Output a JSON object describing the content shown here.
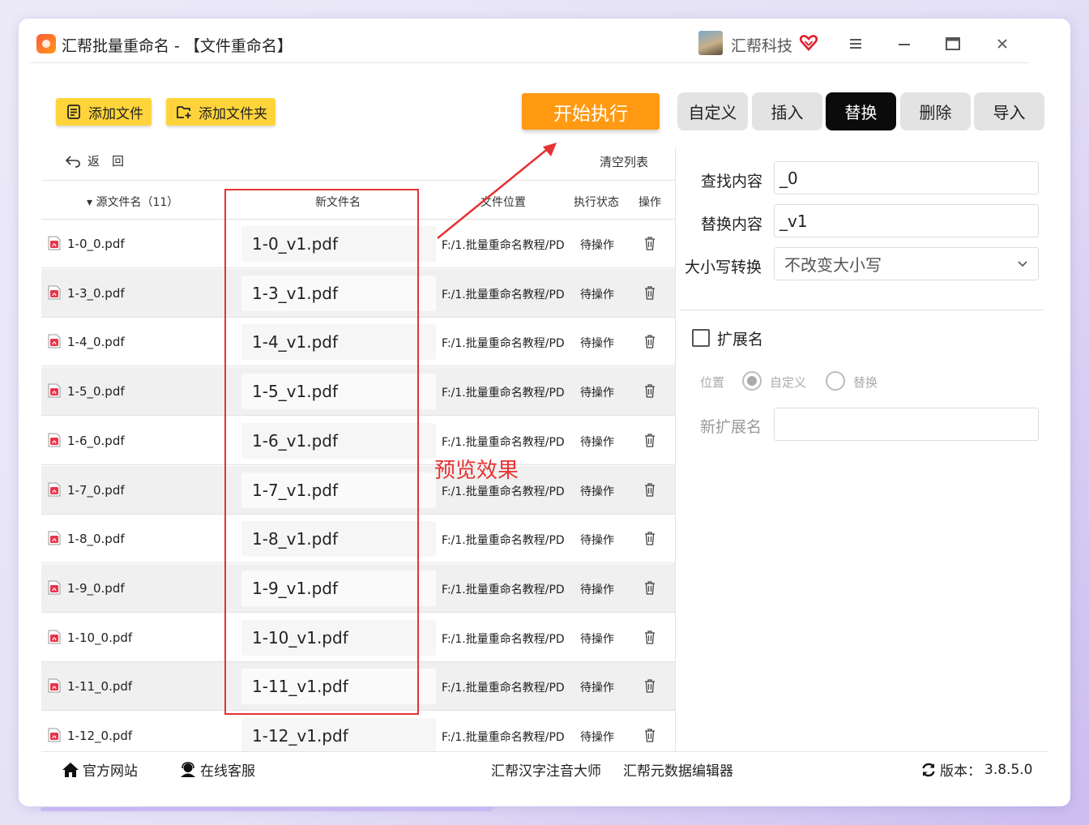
{
  "window": {
    "title": "汇帮批量重命名 - 【文件重命名】",
    "brand": "汇帮科技"
  },
  "toolbar": {
    "add_file": "添加文件",
    "add_folder": "添加文件夹",
    "start": "开始执行"
  },
  "tabs": [
    {
      "label": "自定义",
      "active": false
    },
    {
      "label": "插入",
      "active": false
    },
    {
      "label": "替换",
      "active": true
    },
    {
      "label": "删除",
      "active": false
    },
    {
      "label": "导入",
      "active": false
    }
  ],
  "list": {
    "back": "返　回",
    "clear": "清空列表",
    "headers": {
      "source": "源文件名（11）",
      "new_name": "新文件名",
      "location": "文件位置",
      "status": "执行状态",
      "action": "操作"
    },
    "rows": [
      {
        "source": "1-0_0.pdf",
        "new_name": "1-0_v1.pdf",
        "location": "F:/1.批量重命名教程/PD",
        "status": "待操作"
      },
      {
        "source": "1-3_0.pdf",
        "new_name": "1-3_v1.pdf",
        "location": "F:/1.批量重命名教程/PD",
        "status": "待操作"
      },
      {
        "source": "1-4_0.pdf",
        "new_name": "1-4_v1.pdf",
        "location": "F:/1.批量重命名教程/PD",
        "status": "待操作"
      },
      {
        "source": "1-5_0.pdf",
        "new_name": "1-5_v1.pdf",
        "location": "F:/1.批量重命名教程/PD",
        "status": "待操作"
      },
      {
        "source": "1-6_0.pdf",
        "new_name": "1-6_v1.pdf",
        "location": "F:/1.批量重命名教程/PD",
        "status": "待操作"
      },
      {
        "source": "1-7_0.pdf",
        "new_name": "1-7_v1.pdf",
        "location": "F:/1.批量重命名教程/PD",
        "status": "待操作"
      },
      {
        "source": "1-8_0.pdf",
        "new_name": "1-8_v1.pdf",
        "location": "F:/1.批量重命名教程/PD",
        "status": "待操作"
      },
      {
        "source": "1-9_0.pdf",
        "new_name": "1-9_v1.pdf",
        "location": "F:/1.批量重命名教程/PD",
        "status": "待操作"
      },
      {
        "source": "1-10_0.pdf",
        "new_name": "1-10_v1.pdf",
        "location": "F:/1.批量重命名教程/PD",
        "status": "待操作"
      },
      {
        "source": "1-11_0.pdf",
        "new_name": "1-11_v1.pdf",
        "location": "F:/1.批量重命名教程/PD",
        "status": "待操作"
      },
      {
        "source": "1-12_0.pdf",
        "new_name": "1-12_v1.pdf",
        "location": "F:/1.批量重命名教程/PD",
        "status": "待操作"
      }
    ]
  },
  "annotation": {
    "preview_label": "预览效果",
    "color": "#e63232"
  },
  "replace_panel": {
    "find_label": "查找内容",
    "find_value": "_0",
    "replace_label": "替换内容",
    "replace_value": "_v1",
    "case_label": "大小写转换",
    "case_value": "不改变大小写",
    "ext_label": "扩展名",
    "ext_checked": false,
    "position_label": "位置",
    "position_options": [
      {
        "label": "自定义",
        "selected": true
      },
      {
        "label": "替换",
        "selected": false
      }
    ],
    "new_ext_label": "新扩展名",
    "new_ext_value": ""
  },
  "footer": {
    "website": "官方网站",
    "support": "在线客服",
    "link1": "汇帮汉字注音大师",
    "link2": "汇帮元数据编辑器",
    "version_label": "版本：",
    "version": "3.8.5.0"
  },
  "colors": {
    "yellow_button": "#ffd43a",
    "start_button": "#ff9a12",
    "active_tab": "#0b0b0b"
  }
}
